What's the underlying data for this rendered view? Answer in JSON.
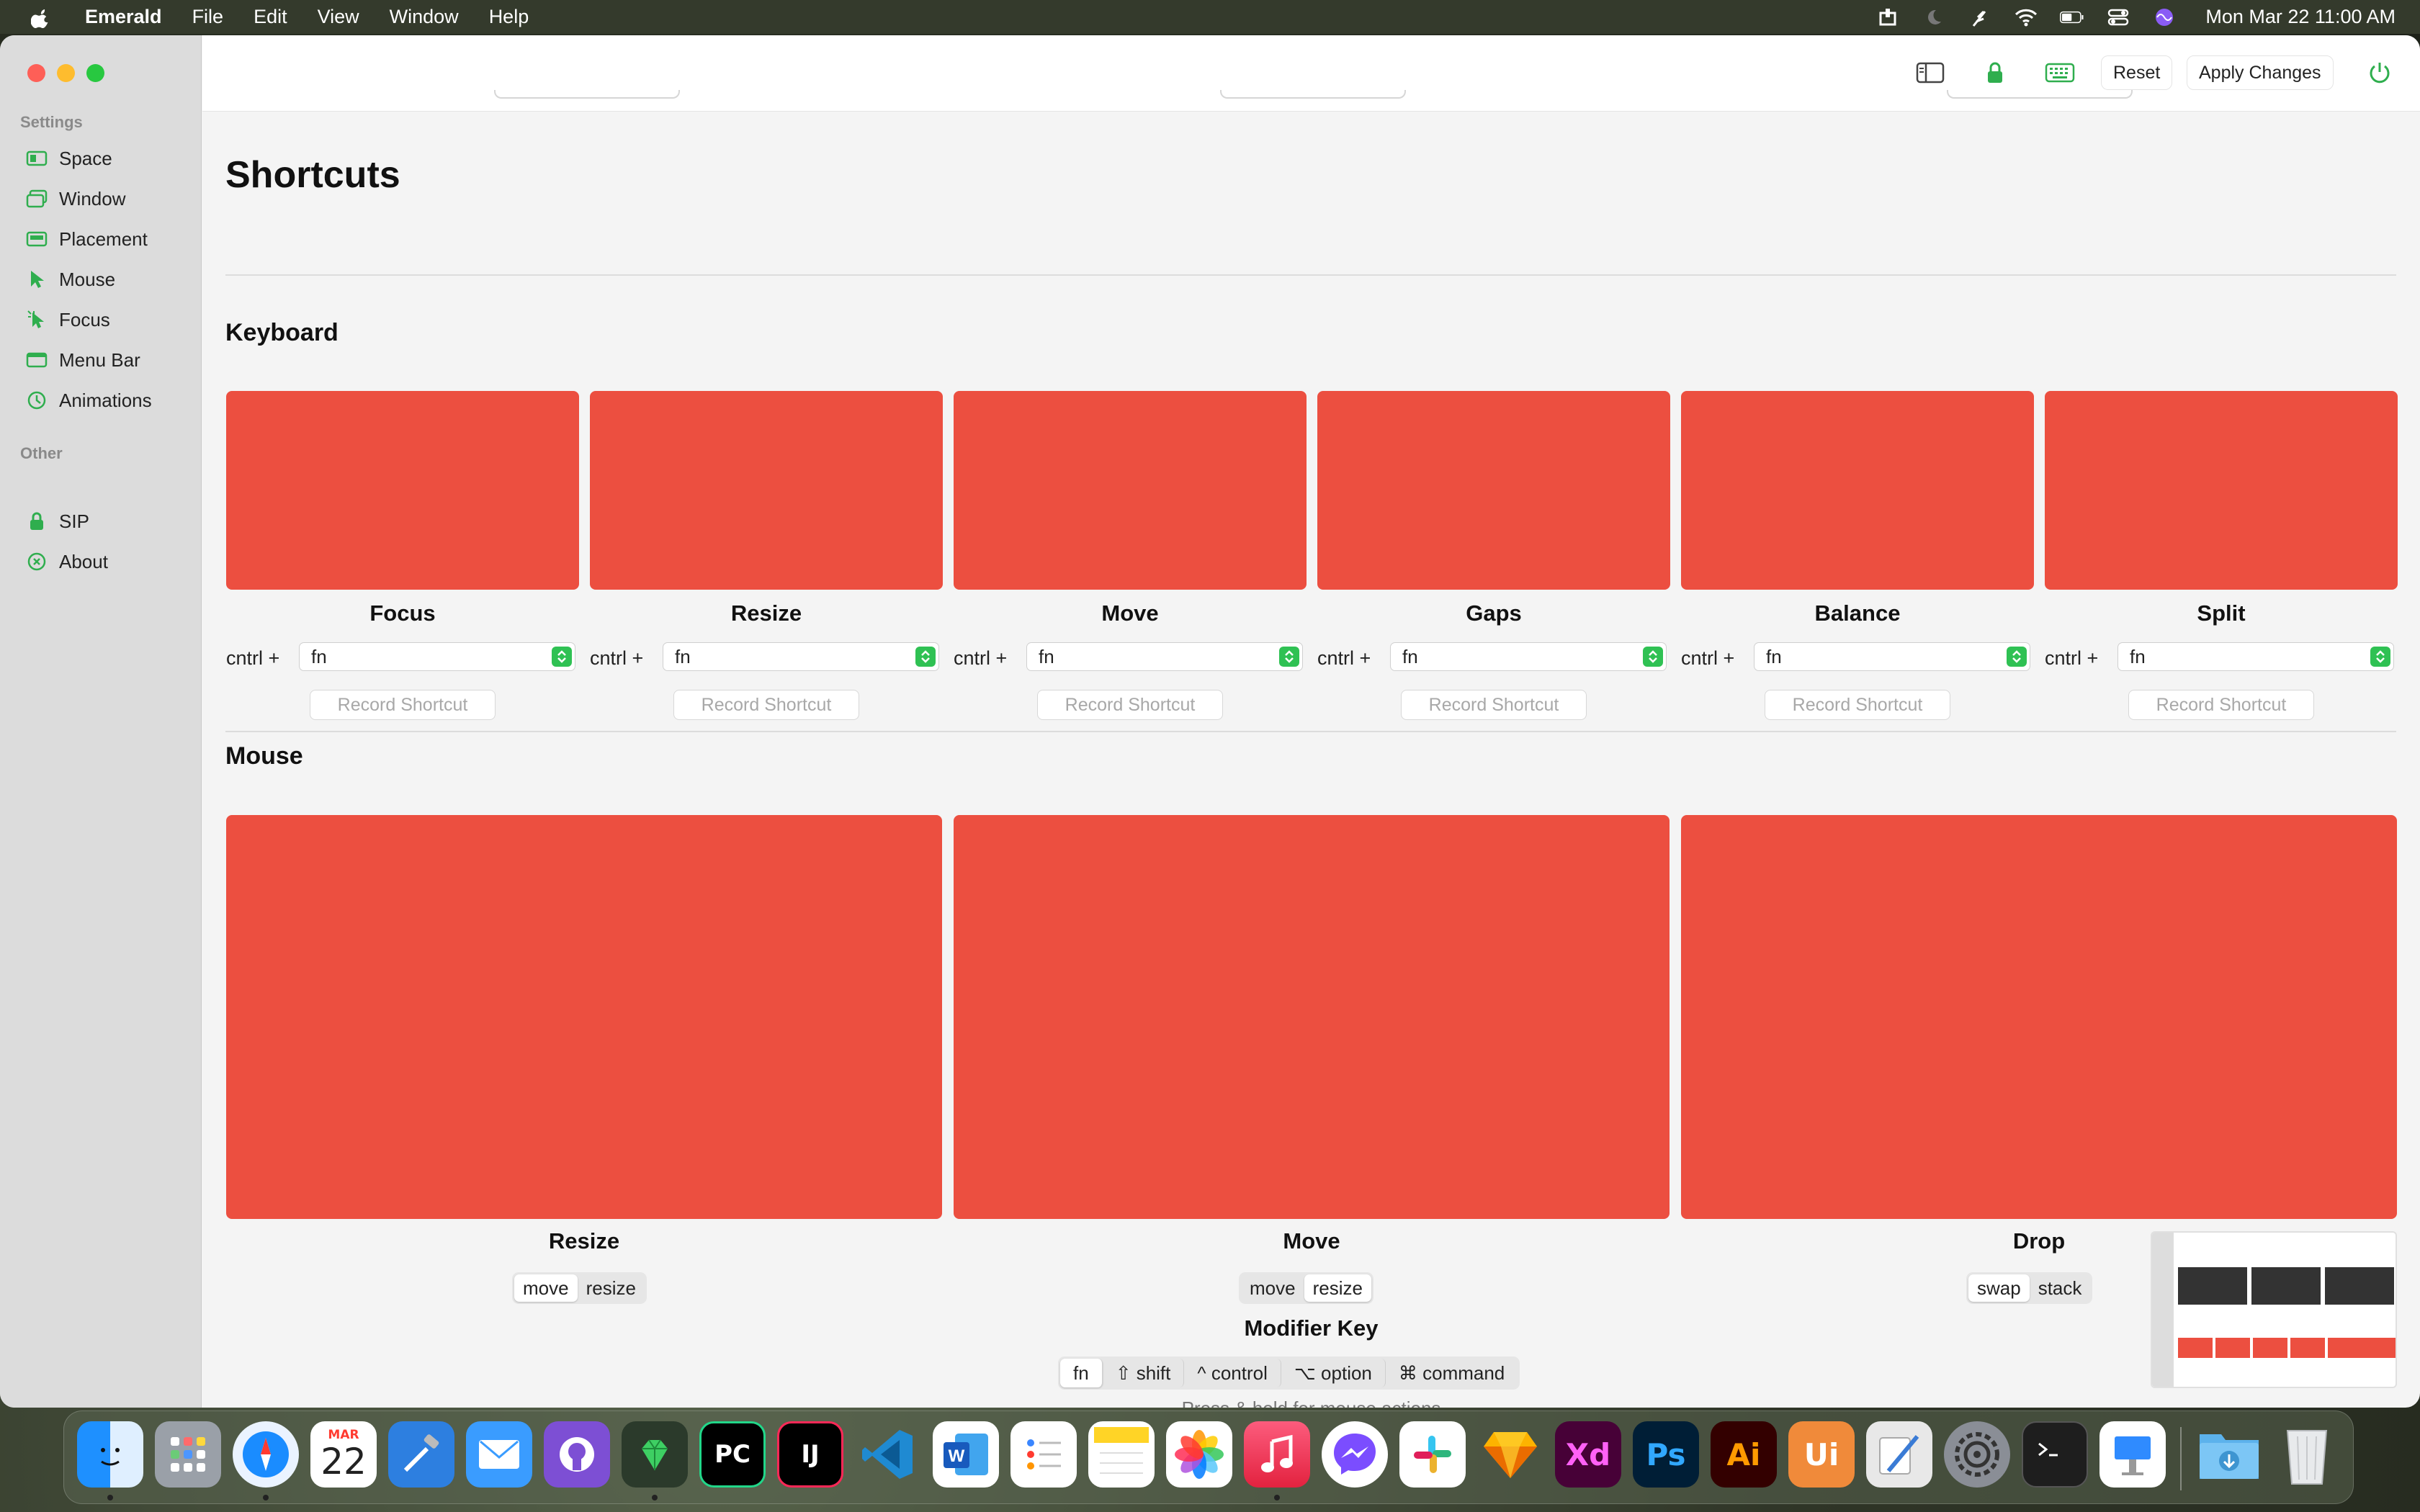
{
  "menubar": {
    "app_name": "Emerald",
    "menus": [
      "File",
      "Edit",
      "View",
      "Window",
      "Help"
    ],
    "clock": "Mon Mar 22  11:00 AM",
    "status_icons": [
      "download-icon",
      "moon-icon",
      "feather-icon",
      "wifi-icon",
      "battery-icon",
      "control-center-icon",
      "siri-icon"
    ]
  },
  "sidebar": {
    "sections": [
      {
        "title": "Settings",
        "items": [
          {
            "label": "Space",
            "icon": "space-icon"
          },
          {
            "label": "Window",
            "icon": "window-icon"
          },
          {
            "label": "Placement",
            "icon": "placement-icon"
          },
          {
            "label": "Mouse",
            "icon": "cursor-icon"
          },
          {
            "label": "Focus",
            "icon": "focus-icon"
          },
          {
            "label": "Menu Bar",
            "icon": "menubar-icon"
          },
          {
            "label": "Animations",
            "icon": "timer-icon"
          }
        ]
      },
      {
        "title": "Other",
        "items": [
          {
            "label": "SIP",
            "icon": "lock-icon"
          },
          {
            "label": "About",
            "icon": "info-icon"
          }
        ]
      }
    ]
  },
  "toolbar": {
    "reset_label": "Reset",
    "apply_label": "Apply Changes",
    "icons": [
      "sidebar-toggle-icon",
      "lock-icon",
      "keyboard-icon",
      "power-icon"
    ]
  },
  "page": {
    "title": "Shortcuts"
  },
  "keyboard": {
    "title": "Keyboard",
    "prefix": "cntrl +",
    "record_label": "Record Shortcut",
    "card_color": "#ec4f40",
    "items": [
      {
        "label": "Focus",
        "key": "fn"
      },
      {
        "label": "Resize",
        "key": "fn"
      },
      {
        "label": "Move",
        "key": "fn"
      },
      {
        "label": "Gaps",
        "key": "fn"
      },
      {
        "label": "Balance",
        "key": "fn"
      },
      {
        "label": "Split",
        "key": "fn"
      }
    ]
  },
  "mouse": {
    "title": "Mouse",
    "items": [
      {
        "label": "Resize",
        "options": [
          "move",
          "resize"
        ],
        "selected": "move"
      },
      {
        "label": "Move",
        "options": [
          "move",
          "resize"
        ],
        "selected": "resize"
      },
      {
        "label": "Drop",
        "options": [
          "swap",
          "stack"
        ],
        "selected": "swap"
      }
    ],
    "modifier_title": "Modifier Key",
    "modifier_options": [
      "fn",
      "⇧ shift",
      "^ control",
      "⌥ option",
      "⌘ command"
    ],
    "modifier_selected": "fn",
    "hint": "Press & hold for mouse actions"
  },
  "dock": {
    "calendar_month": "MAR",
    "calendar_day": "22",
    "apps": [
      "Finder",
      "Launchpad",
      "Safari",
      "Calendar",
      "Xcode",
      "Mail",
      "GitHub Desktop",
      "Emerald",
      "PyCharm",
      "IntelliJ IDEA",
      "Visual Studio Code",
      "Word",
      "Reminders",
      "Notes",
      "Photos",
      "Music",
      "Messenger",
      "Slack",
      "Sketch",
      "Adobe XD",
      "Photoshop",
      "Illustrator",
      "UI Designer",
      "Script Editor",
      "System Preferences",
      "Terminal",
      "Keynote",
      "Downloads",
      "Trash"
    ]
  }
}
